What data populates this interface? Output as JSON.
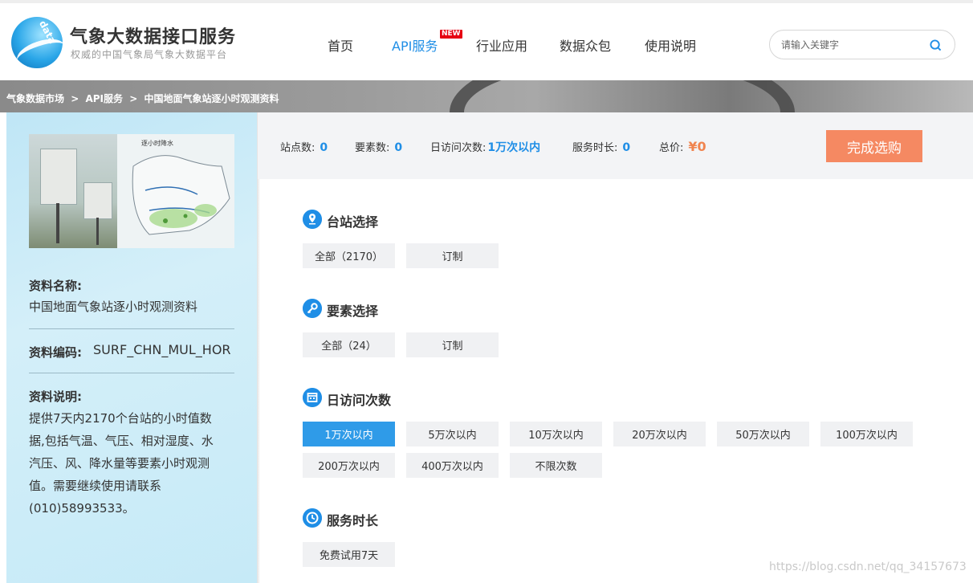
{
  "header": {
    "logo_word": "data",
    "site_title": "气象大数据接口服务",
    "site_subtitle": "权威的中国气象局气象大数据平台",
    "nav": [
      {
        "label": "首页"
      },
      {
        "label": "API服务",
        "badge": "NEW"
      },
      {
        "label": "行业应用"
      },
      {
        "label": "数据众包"
      },
      {
        "label": "使用说明"
      }
    ],
    "search_placeholder": "请输入关键字"
  },
  "breadcrumb": [
    "气象数据市场",
    ">",
    "API服务",
    ">",
    "中国地面气象站逐小时观测资料"
  ],
  "sidebar": {
    "thumb_caption": "逐小时降水",
    "name_label": "资料名称:",
    "name_value": "中国地面气象站逐小时观测资料",
    "code_label": "资料编码:",
    "code_value": "SURF_CHN_MUL_HOR",
    "desc_label": "资料说明:",
    "desc_lines": [
      "提供7天内2170个台站的小时值数",
      "据,包括气温、气压、相对湿度、水",
      "汽压、风、降水量等要素小时观测",
      "值。需要继续使用请联系",
      "(010)58993533。"
    ]
  },
  "summary": {
    "stations_label": "站点数:",
    "stations_value": "0",
    "elements_label": "要素数:",
    "elements_value": "0",
    "daily_label": "日访问次数:",
    "daily_value": "1万次以内",
    "duration_label": "服务时长:",
    "duration_value": "0",
    "total_label": "总价:",
    "total_value": "¥0",
    "buy_label": "完成选购"
  },
  "sections": {
    "stations": {
      "title": "台站选择",
      "options": [
        "全部（2170）",
        "订制"
      ]
    },
    "elements": {
      "title": "要素选择",
      "options": [
        "全部（24）",
        "订制"
      ]
    },
    "daily": {
      "title": "日访问次数",
      "options": [
        "1万次以内",
        "5万次以内",
        "10万次以内",
        "20万次以内",
        "50万次以内",
        "100万次以内",
        "200万次以内",
        "400万次以内",
        "不限次数"
      ],
      "selected": "1万次以内"
    },
    "duration": {
      "title": "服务时长",
      "options": [
        "免费试用7天"
      ]
    }
  },
  "watermark": "https://blog.csdn.net/qq_34157673",
  "colors": {
    "accent": "#1f8ee6",
    "buy": "#f58962",
    "price": "#f0844f",
    "new_badge": "#e60012"
  }
}
